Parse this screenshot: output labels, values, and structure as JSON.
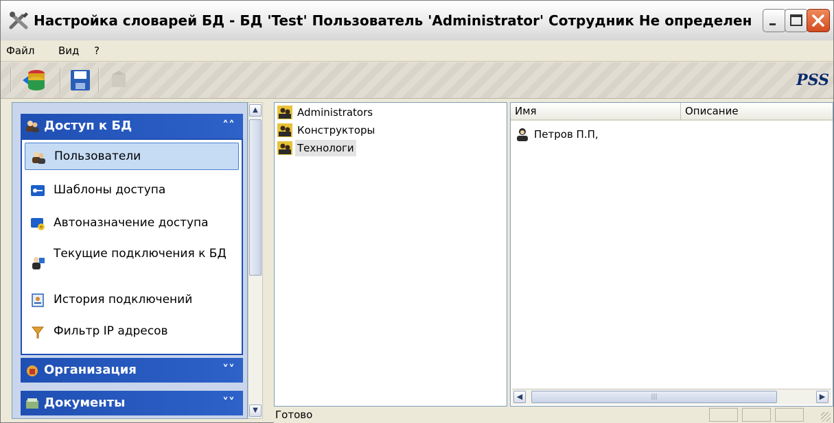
{
  "window": {
    "title": "Настройка словарей БД - БД 'Test' Пользователь 'Administrator' Сотрудник Не определен"
  },
  "menu": [
    "Файл",
    "Вид",
    "?"
  ],
  "toolbar": {
    "brand": "PSS",
    "buttons": [
      "database-icon",
      "save-icon",
      "disabled-tool-icon"
    ]
  },
  "sidebar": {
    "groups": [
      {
        "label": "Доступ к БД",
        "expanded": true,
        "icon": "users-group-icon",
        "items": [
          {
            "label": "Пользователи",
            "icon": "users-icon",
            "selected": true
          },
          {
            "label": "Шаблоны доступа",
            "icon": "key-icon"
          },
          {
            "label": "Автоназначение доступа",
            "icon": "auto-assign-icon"
          },
          {
            "label": "Текущие подключения к БД",
            "icon": "connections-icon"
          },
          {
            "label": "История подключений",
            "icon": "history-icon"
          },
          {
            "label": "Фильтр IP адресов",
            "icon": "filter-icon"
          }
        ]
      },
      {
        "label": "Организация",
        "expanded": false,
        "icon": "organization-icon"
      },
      {
        "label": "Документы",
        "expanded": false,
        "icon": "documents-icon"
      }
    ]
  },
  "groups_tree": {
    "items": [
      {
        "label": "Administrators"
      },
      {
        "label": "Конструкторы"
      },
      {
        "label": "Технологи",
        "selected": true
      }
    ]
  },
  "users_list": {
    "columns": [
      "Имя",
      "Описание"
    ],
    "rows": [
      {
        "name": "Петров П.П,",
        "description": ""
      }
    ]
  },
  "status": {
    "text": "Готово"
  },
  "colors": {
    "accent": "#1f4fb3",
    "panel_background": "#c8d5ec",
    "chrome": "#ece9d8"
  }
}
